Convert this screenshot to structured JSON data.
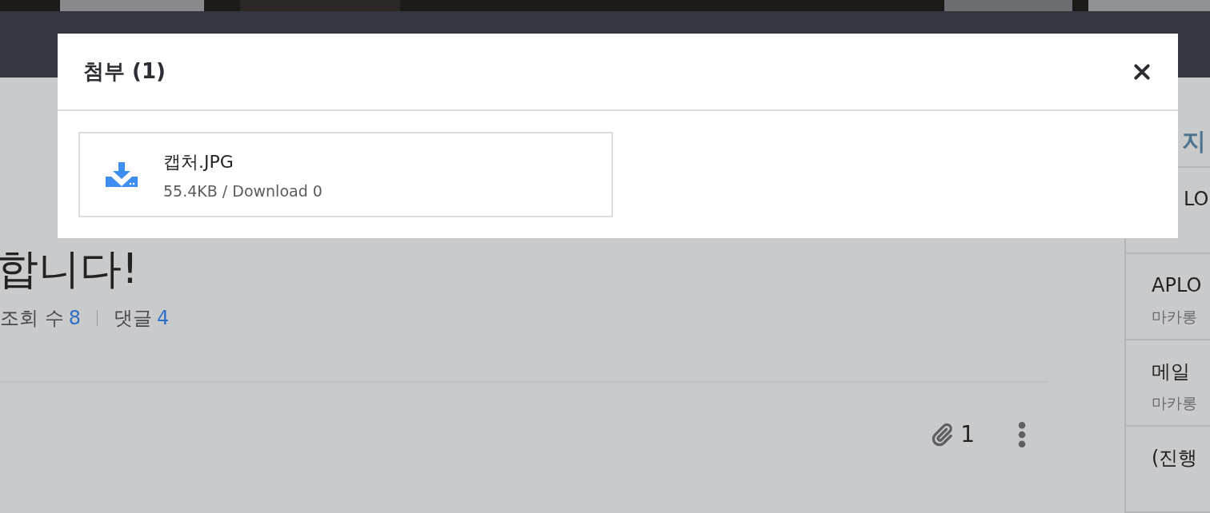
{
  "page": {
    "title": "합니다!",
    "meta": [
      {
        "label": "조회 수",
        "value": "8"
      },
      {
        "label": "댓글",
        "value": "4"
      }
    ],
    "attachment_count": "1"
  },
  "sidebar": {
    "title": "지",
    "items": [
      {
        "title": "LO"
      },
      {
        "title": "APLO",
        "author": "마카롱"
      },
      {
        "title": "메일",
        "author": "마카롱"
      },
      {
        "title": "(진행"
      }
    ]
  },
  "modal": {
    "title": "첨부 (1)",
    "files": [
      {
        "name": "캡처.JPG",
        "info": "55.4KB / Download 0"
      }
    ]
  }
}
